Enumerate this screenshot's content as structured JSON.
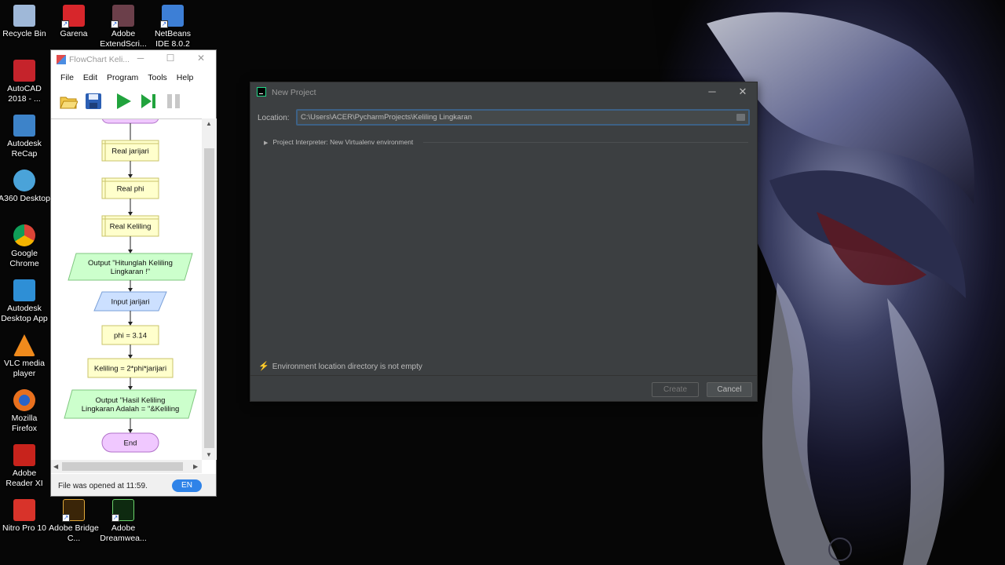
{
  "desktop": {
    "icons": [
      {
        "label": "Recycle Bin",
        "icon": "recycle-bin-icon",
        "color": "#9fb8d8"
      },
      {
        "label": "Garena",
        "icon": "garena-icon",
        "color": "#d7262b"
      },
      {
        "label": "Adobe ExtendScri...",
        "icon": "adobe-extendscript-icon",
        "color": "#6b3f4a"
      },
      {
        "label": "NetBeans IDE 8.0.2",
        "icon": "netbeans-icon",
        "color": "#3d7fd6"
      },
      {
        "label": "AutoCAD 2018 - ...",
        "icon": "autocad-icon",
        "color": "#c5232b"
      },
      {
        "label": "Autodesk ReCap",
        "icon": "autodesk-recap-icon",
        "color": "#3d83c9"
      },
      {
        "label": "A360 Desktop",
        "icon": "a360-icon",
        "color": "#4aa3d9"
      },
      {
        "label": "Google Chrome",
        "icon": "chrome-icon",
        "color": "#e8b527"
      },
      {
        "label": "Autodesk Desktop App",
        "icon": "autodesk-desktop-app-icon",
        "color": "#2e8fd6"
      },
      {
        "label": "VLC media player",
        "icon": "vlc-icon",
        "color": "#f08a1c"
      },
      {
        "label": "Mozilla Firefox",
        "icon": "firefox-icon",
        "color": "#e8701e"
      },
      {
        "label": "Adobe Reader XI",
        "icon": "adobe-reader-icon",
        "color": "#c8231c"
      },
      {
        "label": "Nitro Pro 10",
        "icon": "nitro-pro-icon",
        "color": "#d8332a"
      },
      {
        "label": "Adobe Bridge C...",
        "icon": "adobe-bridge-icon",
        "color": "#3a2508"
      },
      {
        "label": "Adobe Dreamwea...",
        "icon": "adobe-dreamweaver-icon",
        "color": "#0e2a10"
      }
    ]
  },
  "flowchart_window": {
    "title": "FlowChart Keli...",
    "menu": [
      "File",
      "Edit",
      "Program",
      "Tools",
      "Help"
    ],
    "toolbar": [
      "open-icon",
      "save-icon",
      "run-icon",
      "step-icon",
      "pause-icon"
    ],
    "nodes": [
      {
        "text": "Real jarijari",
        "kind": "declare"
      },
      {
        "text": "Real phi",
        "kind": "declare"
      },
      {
        "text": "Real Keliling",
        "kind": "declare"
      },
      {
        "text": "Output \"Hitunglah Keliling Lingkaran !\"",
        "kind": "output"
      },
      {
        "text": "Input jarijari",
        "kind": "input"
      },
      {
        "text": "phi = 3.14",
        "kind": "assign"
      },
      {
        "text": "Keliling = 2*phi*jarijari",
        "kind": "assign"
      },
      {
        "text": "Output \"Hasil Keliling Lingkaran Adalah = \"&Keliling",
        "kind": "output"
      },
      {
        "text": "End",
        "kind": "terminal"
      }
    ],
    "status": {
      "message": "File was opened at 11:59.",
      "language": "EN"
    }
  },
  "new_project_dialog": {
    "title": "New Project",
    "location_label": "Location:",
    "location_value": "C:\\Users\\ACER\\PycharmProjects\\Keliling Lingkaran",
    "interpreter_label": "Project Interpreter: New Virtualenv environment",
    "warning": "Environment location directory is not empty",
    "create_label": "Create",
    "cancel_label": "Cancel"
  },
  "colors": {
    "dialog_bg": "#3c3f41",
    "field_focus": "#3d6185",
    "declare_fill": "#ffffcc",
    "output_fill": "#ccffcc",
    "input_fill": "#cce0ff",
    "terminal_fill": "#f0c8ff",
    "lang_badge": "#2f83e8"
  }
}
